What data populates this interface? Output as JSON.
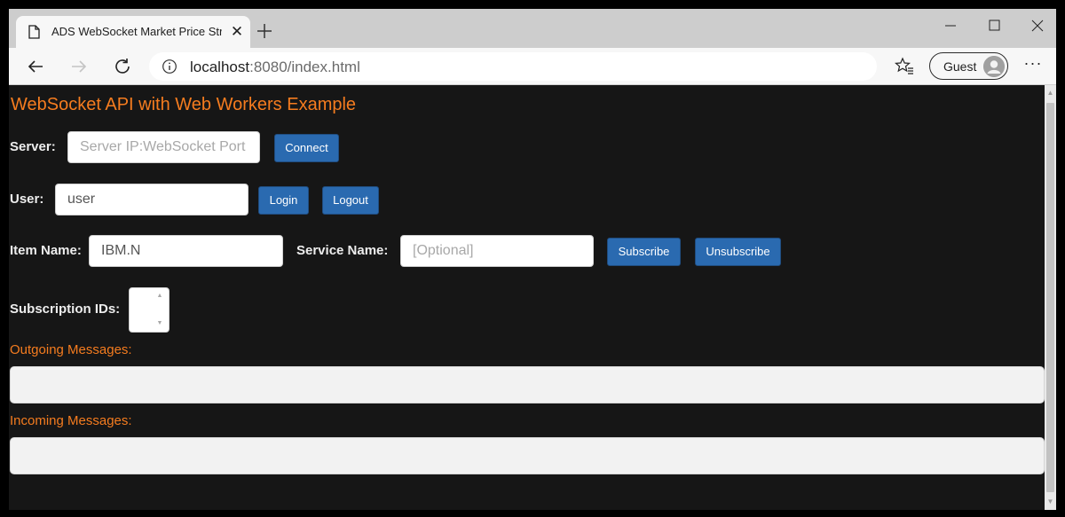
{
  "browser": {
    "tab_title": "ADS WebSocket Market Price Str",
    "tab_close_glyph": "✕",
    "url_host": "localhost",
    "url_rest": ":8080/index.html",
    "profile_label": "Guest",
    "more_glyph": "···"
  },
  "page": {
    "heading": "WebSocket API with Web Workers Example",
    "server": {
      "label": "Server:",
      "placeholder": "Server IP:WebSocket Port",
      "connect_label": "Connect"
    },
    "user": {
      "label": "User:",
      "value": "user",
      "login_label": "Login",
      "logout_label": "Logout"
    },
    "item": {
      "label": "Item Name:",
      "value": "IBM.N",
      "service_label": "Service Name:",
      "service_placeholder": "[Optional]",
      "subscribe_label": "Subscribe",
      "unsubscribe_label": "Unsubscribe"
    },
    "subscription_ids_label": "Subscription IDs:",
    "outgoing_label": "Outgoing Messages:",
    "incoming_label": "Incoming Messages:"
  },
  "colors": {
    "accent": "#f57c1f",
    "button": "#2a6ab0",
    "page_bg": "#161616"
  },
  "icons": [
    "page-icon",
    "close-icon",
    "plus-icon",
    "minimize-icon",
    "maximize-icon",
    "window-close-icon",
    "back-arrow-icon",
    "forward-arrow-icon",
    "reload-icon",
    "info-icon",
    "favorites-icon",
    "avatar-icon",
    "more-icon"
  ]
}
